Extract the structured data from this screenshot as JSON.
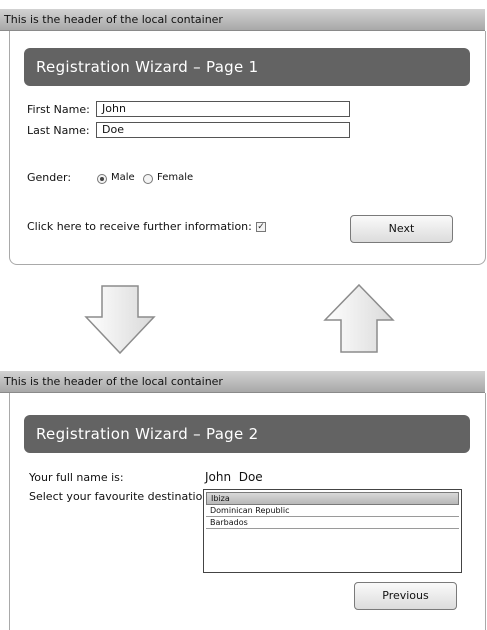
{
  "page1": {
    "container_header": "This is the header of the local container",
    "title": "Registration Wizard – Page 1",
    "first_name_label": "First Name:",
    "first_name_value": "John",
    "last_name_label": "Last Name:",
    "last_name_value": "Doe",
    "gender_label": "Gender:",
    "gender_options": [
      "Male",
      "Female"
    ],
    "gender_selected": "Male",
    "info_label": "Click here to receive further information:",
    "info_checked": true,
    "next_button": "Next"
  },
  "page2": {
    "container_header": "This is the header of the local container",
    "title": "Registration Wizard – Page 2",
    "full_name_label": "Your full name is:",
    "full_name_value": "John  Doe",
    "destination_label": "Select your favourite destination:",
    "destinations": [
      "Ibiza",
      "Dominican Republic",
      "Barbados"
    ],
    "selected_destination": "Ibiza",
    "previous_button": "Previous"
  },
  "icons": {
    "down_arrow": "arrow-down-icon",
    "up_arrow": "arrow-up-icon"
  }
}
